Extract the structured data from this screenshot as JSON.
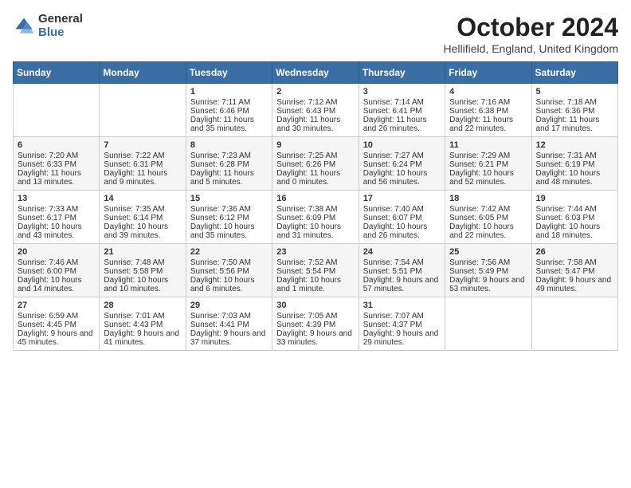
{
  "logo": {
    "general": "General",
    "blue": "Blue"
  },
  "header": {
    "title": "October 2024",
    "location": "Hellifield, England, United Kingdom"
  },
  "days_of_week": [
    "Sunday",
    "Monday",
    "Tuesday",
    "Wednesday",
    "Thursday",
    "Friday",
    "Saturday"
  ],
  "weeks": [
    [
      {
        "day": "",
        "sunrise": "",
        "sunset": "",
        "daylight": ""
      },
      {
        "day": "",
        "sunrise": "",
        "sunset": "",
        "daylight": ""
      },
      {
        "day": "1",
        "sunrise": "Sunrise: 7:11 AM",
        "sunset": "Sunset: 6:46 PM",
        "daylight": "Daylight: 11 hours and 35 minutes."
      },
      {
        "day": "2",
        "sunrise": "Sunrise: 7:12 AM",
        "sunset": "Sunset: 6:43 PM",
        "daylight": "Daylight: 11 hours and 30 minutes."
      },
      {
        "day": "3",
        "sunrise": "Sunrise: 7:14 AM",
        "sunset": "Sunset: 6:41 PM",
        "daylight": "Daylight: 11 hours and 26 minutes."
      },
      {
        "day": "4",
        "sunrise": "Sunrise: 7:16 AM",
        "sunset": "Sunset: 6:38 PM",
        "daylight": "Daylight: 11 hours and 22 minutes."
      },
      {
        "day": "5",
        "sunrise": "Sunrise: 7:18 AM",
        "sunset": "Sunset: 6:36 PM",
        "daylight": "Daylight: 11 hours and 17 minutes."
      }
    ],
    [
      {
        "day": "6",
        "sunrise": "Sunrise: 7:20 AM",
        "sunset": "Sunset: 6:33 PM",
        "daylight": "Daylight: 11 hours and 13 minutes."
      },
      {
        "day": "7",
        "sunrise": "Sunrise: 7:22 AM",
        "sunset": "Sunset: 6:31 PM",
        "daylight": "Daylight: 11 hours and 9 minutes."
      },
      {
        "day": "8",
        "sunrise": "Sunrise: 7:23 AM",
        "sunset": "Sunset: 6:28 PM",
        "daylight": "Daylight: 11 hours and 5 minutes."
      },
      {
        "day": "9",
        "sunrise": "Sunrise: 7:25 AM",
        "sunset": "Sunset: 6:26 PM",
        "daylight": "Daylight: 11 hours and 0 minutes."
      },
      {
        "day": "10",
        "sunrise": "Sunrise: 7:27 AM",
        "sunset": "Sunset: 6:24 PM",
        "daylight": "Daylight: 10 hours and 56 minutes."
      },
      {
        "day": "11",
        "sunrise": "Sunrise: 7:29 AM",
        "sunset": "Sunset: 6:21 PM",
        "daylight": "Daylight: 10 hours and 52 minutes."
      },
      {
        "day": "12",
        "sunrise": "Sunrise: 7:31 AM",
        "sunset": "Sunset: 6:19 PM",
        "daylight": "Daylight: 10 hours and 48 minutes."
      }
    ],
    [
      {
        "day": "13",
        "sunrise": "Sunrise: 7:33 AM",
        "sunset": "Sunset: 6:17 PM",
        "daylight": "Daylight: 10 hours and 43 minutes."
      },
      {
        "day": "14",
        "sunrise": "Sunrise: 7:35 AM",
        "sunset": "Sunset: 6:14 PM",
        "daylight": "Daylight: 10 hours and 39 minutes."
      },
      {
        "day": "15",
        "sunrise": "Sunrise: 7:36 AM",
        "sunset": "Sunset: 6:12 PM",
        "daylight": "Daylight: 10 hours and 35 minutes."
      },
      {
        "day": "16",
        "sunrise": "Sunrise: 7:38 AM",
        "sunset": "Sunset: 6:09 PM",
        "daylight": "Daylight: 10 hours and 31 minutes."
      },
      {
        "day": "17",
        "sunrise": "Sunrise: 7:40 AM",
        "sunset": "Sunset: 6:07 PM",
        "daylight": "Daylight: 10 hours and 26 minutes."
      },
      {
        "day": "18",
        "sunrise": "Sunrise: 7:42 AM",
        "sunset": "Sunset: 6:05 PM",
        "daylight": "Daylight: 10 hours and 22 minutes."
      },
      {
        "day": "19",
        "sunrise": "Sunrise: 7:44 AM",
        "sunset": "Sunset: 6:03 PM",
        "daylight": "Daylight: 10 hours and 18 minutes."
      }
    ],
    [
      {
        "day": "20",
        "sunrise": "Sunrise: 7:46 AM",
        "sunset": "Sunset: 6:00 PM",
        "daylight": "Daylight: 10 hours and 14 minutes."
      },
      {
        "day": "21",
        "sunrise": "Sunrise: 7:48 AM",
        "sunset": "Sunset: 5:58 PM",
        "daylight": "Daylight: 10 hours and 10 minutes."
      },
      {
        "day": "22",
        "sunrise": "Sunrise: 7:50 AM",
        "sunset": "Sunset: 5:56 PM",
        "daylight": "Daylight: 10 hours and 6 minutes."
      },
      {
        "day": "23",
        "sunrise": "Sunrise: 7:52 AM",
        "sunset": "Sunset: 5:54 PM",
        "daylight": "Daylight: 10 hours and 1 minute."
      },
      {
        "day": "24",
        "sunrise": "Sunrise: 7:54 AM",
        "sunset": "Sunset: 5:51 PM",
        "daylight": "Daylight: 9 hours and 57 minutes."
      },
      {
        "day": "25",
        "sunrise": "Sunrise: 7:56 AM",
        "sunset": "Sunset: 5:49 PM",
        "daylight": "Daylight: 9 hours and 53 minutes."
      },
      {
        "day": "26",
        "sunrise": "Sunrise: 7:58 AM",
        "sunset": "Sunset: 5:47 PM",
        "daylight": "Daylight: 9 hours and 49 minutes."
      }
    ],
    [
      {
        "day": "27",
        "sunrise": "Sunrise: 6:59 AM",
        "sunset": "Sunset: 4:45 PM",
        "daylight": "Daylight: 9 hours and 45 minutes."
      },
      {
        "day": "28",
        "sunrise": "Sunrise: 7:01 AM",
        "sunset": "Sunset: 4:43 PM",
        "daylight": "Daylight: 9 hours and 41 minutes."
      },
      {
        "day": "29",
        "sunrise": "Sunrise: 7:03 AM",
        "sunset": "Sunset: 4:41 PM",
        "daylight": "Daylight: 9 hours and 37 minutes."
      },
      {
        "day": "30",
        "sunrise": "Sunrise: 7:05 AM",
        "sunset": "Sunset: 4:39 PM",
        "daylight": "Daylight: 9 hours and 33 minutes."
      },
      {
        "day": "31",
        "sunrise": "Sunrise: 7:07 AM",
        "sunset": "Sunset: 4:37 PM",
        "daylight": "Daylight: 9 hours and 29 minutes."
      },
      {
        "day": "",
        "sunrise": "",
        "sunset": "",
        "daylight": ""
      },
      {
        "day": "",
        "sunrise": "",
        "sunset": "",
        "daylight": ""
      }
    ]
  ]
}
